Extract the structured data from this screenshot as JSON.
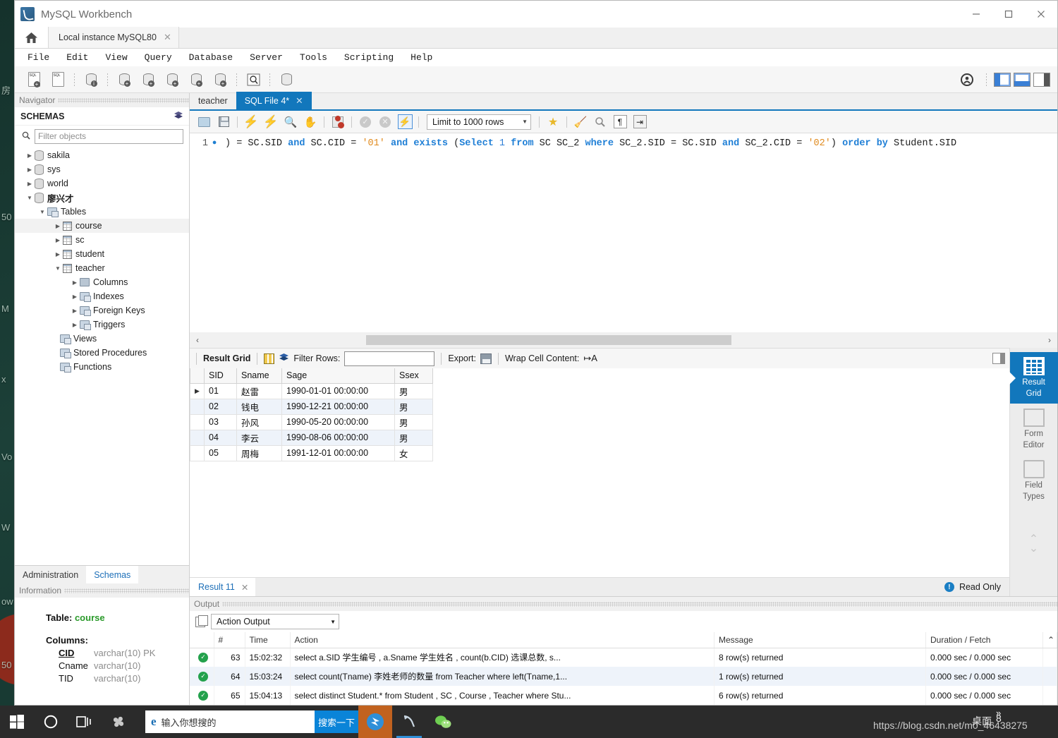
{
  "window": {
    "app_title": "MySQL Workbench",
    "app_icon": "dolphin-icon",
    "minimize_label": "—",
    "maximize_label": "□",
    "close_label": "✕"
  },
  "connection_tabs": {
    "home_icon": "home-icon",
    "tabs": [
      {
        "label": "Local instance MySQL80",
        "close": "✕"
      }
    ]
  },
  "menubar": [
    "File",
    "Edit",
    "View",
    "Query",
    "Database",
    "Server",
    "Tools",
    "Scripting",
    "Help"
  ],
  "app_toolbar": {
    "icons": [
      "new-sql-tab-icon",
      "open-sql-script-icon",
      "connect-to-database-icon",
      "new-schema-icon",
      "new-table-icon",
      "new-view-icon",
      "new-procedure-icon",
      "new-function-icon",
      "search-data-icon",
      "reverse-engineer-icon"
    ],
    "right_icons": [
      "admin-shield-icon",
      "toggle-sidebar-icon",
      "toggle-output-icon",
      "toggle-secondary-sidebar-icon"
    ]
  },
  "navigator": {
    "panel_title": "Navigator",
    "section_title": "SCHEMAS",
    "refresh_icon": "refresh-icon",
    "search_icon": "search-icon",
    "filter_placeholder": "Filter objects",
    "filter_value": "",
    "tree": [
      {
        "label": "sakila",
        "icon": "schema-icon",
        "indent": 0,
        "state": "closed"
      },
      {
        "label": "sys",
        "icon": "schema-icon",
        "indent": 0,
        "state": "closed"
      },
      {
        "label": "world",
        "icon": "schema-icon",
        "indent": 0,
        "state": "closed"
      },
      {
        "label": "廖兴才",
        "icon": "schema-icon",
        "indent": 0,
        "state": "open",
        "bold": true
      },
      {
        "label": "Tables",
        "icon": "folder-icon",
        "indent": 1,
        "state": "open"
      },
      {
        "label": "course",
        "icon": "table-icon",
        "indent": 2,
        "state": "closed",
        "selected": true
      },
      {
        "label": "sc",
        "icon": "table-icon",
        "indent": 2,
        "state": "closed"
      },
      {
        "label": "student",
        "icon": "table-icon",
        "indent": 2,
        "state": "closed"
      },
      {
        "label": "teacher",
        "icon": "table-icon",
        "indent": 2,
        "state": "open"
      },
      {
        "label": "Columns",
        "icon": "columns-icon",
        "indent": 3,
        "state": "closed"
      },
      {
        "label": "Indexes",
        "icon": "folder-icon",
        "indent": 3,
        "state": "closed"
      },
      {
        "label": "Foreign Keys",
        "icon": "folder-icon",
        "indent": 3,
        "state": "closed"
      },
      {
        "label": "Triggers",
        "icon": "folder-icon",
        "indent": 3,
        "state": "closed"
      },
      {
        "label": "Views",
        "icon": "folder-icon",
        "indent": 1,
        "state": "none"
      },
      {
        "label": "Stored Procedures",
        "icon": "folder-icon",
        "indent": 1,
        "state": "none"
      },
      {
        "label": "Functions",
        "icon": "folder-icon",
        "indent": 1,
        "state": "none"
      }
    ],
    "bottom_tabs": [
      {
        "label": "Administration",
        "active": false
      },
      {
        "label": "Schemas",
        "active": true
      }
    ]
  },
  "information": {
    "panel_title": "Information",
    "table_label": "Table:",
    "table_name": "course",
    "columns_label": "Columns:",
    "columns": [
      {
        "name": "CID",
        "type": "varchar(10) PK",
        "pk": true
      },
      {
        "name": "Cname",
        "type": "varchar(10)",
        "pk": false
      },
      {
        "name": "TID",
        "type": "varchar(10)",
        "pk": false
      }
    ]
  },
  "editor": {
    "tabs": [
      {
        "label": "teacher",
        "active": false,
        "close": ""
      },
      {
        "label": "SQL File 4*",
        "active": true,
        "close": "✕"
      }
    ],
    "toolbar": {
      "icons": [
        "open-file-icon",
        "save-file-icon",
        "execute-icon",
        "execute-current-statement-icon",
        "explain-icon",
        "stop-icon",
        "toggle-breakpoint-icon",
        "commit-icon",
        "rollback-icon",
        "auto-commit-icon"
      ],
      "limit_label": "Limit to 1000 rows",
      "limit_caret": "▼",
      "right_icons": [
        "add-snippet-icon",
        "beautify-sql-icon",
        "find-icon",
        "show-invisible-chars-icon",
        "wrap-lines-icon"
      ]
    },
    "line_number": "1",
    "breakpoint_marker": "●",
    "sql_tokens": [
      {
        "t": ") = SC.SID ",
        "c": "id"
      },
      {
        "t": "and",
        "c": "kw"
      },
      {
        "t": " SC.CID = ",
        "c": "id"
      },
      {
        "t": "'01'",
        "c": "str"
      },
      {
        "t": " ",
        "c": "id"
      },
      {
        "t": "and",
        "c": "kw"
      },
      {
        "t": " ",
        "c": "id"
      },
      {
        "t": "exists",
        "c": "kw"
      },
      {
        "t": " (",
        "c": "id"
      },
      {
        "t": "Select",
        "c": "kw"
      },
      {
        "t": " ",
        "c": "id"
      },
      {
        "t": "1",
        "c": "num"
      },
      {
        "t": " ",
        "c": "id"
      },
      {
        "t": "from",
        "c": "kw"
      },
      {
        "t": " SC SC_2 ",
        "c": "id"
      },
      {
        "t": "where",
        "c": "kw"
      },
      {
        "t": " SC_2.SID = SC.SID ",
        "c": "id"
      },
      {
        "t": "and",
        "c": "kw"
      },
      {
        "t": " SC_2.CID = ",
        "c": "id"
      },
      {
        "t": "'02'",
        "c": "str"
      },
      {
        "t": ") ",
        "c": "id"
      },
      {
        "t": "order",
        "c": "kw"
      },
      {
        "t": " ",
        "c": "id"
      },
      {
        "t": "by",
        "c": "kw"
      },
      {
        "t": " Student.SID",
        "c": "id"
      }
    ],
    "scroll_left_icon": "‹",
    "scroll_right_icon": "›"
  },
  "results": {
    "toolbar": {
      "title": "Result Grid",
      "grid_icon": "grid-view-icon",
      "refresh_icon": "refresh-grid-icon",
      "filter_label": "Filter Rows:",
      "filter_value": "",
      "export_label": "Export:",
      "export_icon": "export-recordset-icon",
      "wrap_label": "Wrap Cell Content:",
      "wrap_icon": "wrap-cell-icon",
      "panel_toggle_icon": "toggle-panel-icon"
    },
    "columns": [
      "SID",
      "Sname",
      "Sage",
      "Ssex"
    ],
    "rows": [
      {
        "marker": "▶",
        "SID": "01",
        "Sname": "赵雷",
        "Sage": "1990-01-01 00:00:00",
        "Ssex": "男"
      },
      {
        "marker": "",
        "SID": "02",
        "Sname": "钱电",
        "Sage": "1990-12-21 00:00:00",
        "Ssex": "男"
      },
      {
        "marker": "",
        "SID": "03",
        "Sname": "孙风",
        "Sage": "1990-05-20 00:00:00",
        "Ssex": "男"
      },
      {
        "marker": "",
        "SID": "04",
        "Sname": "李云",
        "Sage": "1990-08-06 00:00:00",
        "Ssex": "男"
      },
      {
        "marker": "",
        "SID": "05",
        "Sname": "周梅",
        "Sage": "1991-12-01 00:00:00",
        "Ssex": "女"
      }
    ],
    "result_tab": {
      "label": "Result 11",
      "close": "✕"
    },
    "read_only": {
      "icon": "info-icon",
      "label": "Read Only"
    },
    "side_buttons": [
      {
        "label_1": "Result",
        "label_2": "Grid",
        "icon": "result-grid-icon",
        "active": true
      },
      {
        "label_1": "Form",
        "label_2": "Editor",
        "icon": "form-editor-icon",
        "active": false
      },
      {
        "label_1": "Field",
        "label_2": "Types",
        "icon": "field-types-icon",
        "active": false
      }
    ],
    "spinner_up": "⌃",
    "spinner_down": "⌄"
  },
  "output": {
    "panel_title": "Output",
    "copy_icon": "copy-icon",
    "selector_value": "Action Output",
    "selector_caret": "▼",
    "columns": [
      "",
      "#",
      "Time",
      "Action",
      "Message",
      "Duration / Fetch"
    ],
    "rows": [
      {
        "status": "success",
        "status_icon": "check-circle-icon",
        "num": "63",
        "time": "15:02:32",
        "action": "select a.SID 学生编号 , a.Sname 学生姓名 , count(b.CID) 选课总数, s...",
        "message": "8 row(s) returned",
        "duration": "0.000 sec / 0.000 sec"
      },
      {
        "status": "success",
        "status_icon": "check-circle-icon",
        "num": "64",
        "time": "15:03:24",
        "action": "select count(Tname) 李姓老师的数量 from Teacher where left(Tname,1...",
        "message": "1 row(s) returned",
        "duration": "0.000 sec / 0.000 sec"
      },
      {
        "status": "success",
        "status_icon": "check-circle-icon",
        "num": "65",
        "time": "15:04:13",
        "action": "select distinct Student.* from Student , SC , Course , Teacher  where Stu...",
        "message": "6 row(s) returned",
        "duration": "0.000 sec / 0.000 sec"
      }
    ],
    "scroll_up_icon": "⌃"
  },
  "taskbar": {
    "start_icon": "windows-start-icon",
    "cortana_icon": "cortana-circle-icon",
    "taskview_icon": "task-view-icon",
    "apps_icon": "fan-app-icon",
    "search": {
      "browser_icon": "edge-icon",
      "placeholder": "输入你想搜的",
      "button_label": "搜索一下"
    },
    "pinned": [
      {
        "icon": "thunder-app-icon",
        "accent": true
      },
      {
        "icon": "mysql-workbench-icon",
        "accent": false
      },
      {
        "icon": "wechat-icon",
        "accent": false
      }
    ],
    "tray": {
      "chevron": "»",
      "desktop_label": "桌面",
      "count": "8"
    },
    "watermark": "https://blog.csdn.net/m0_46438275"
  },
  "desktop": {
    "ghost_texts": [
      "房",
      "50",
      "M",
      "x",
      "Vo",
      "W",
      "ow",
      "50"
    ],
    "colors": {
      "accent": "#1277bc",
      "taskbar": "#2b2b2b",
      "success": "#23a14c"
    }
  }
}
